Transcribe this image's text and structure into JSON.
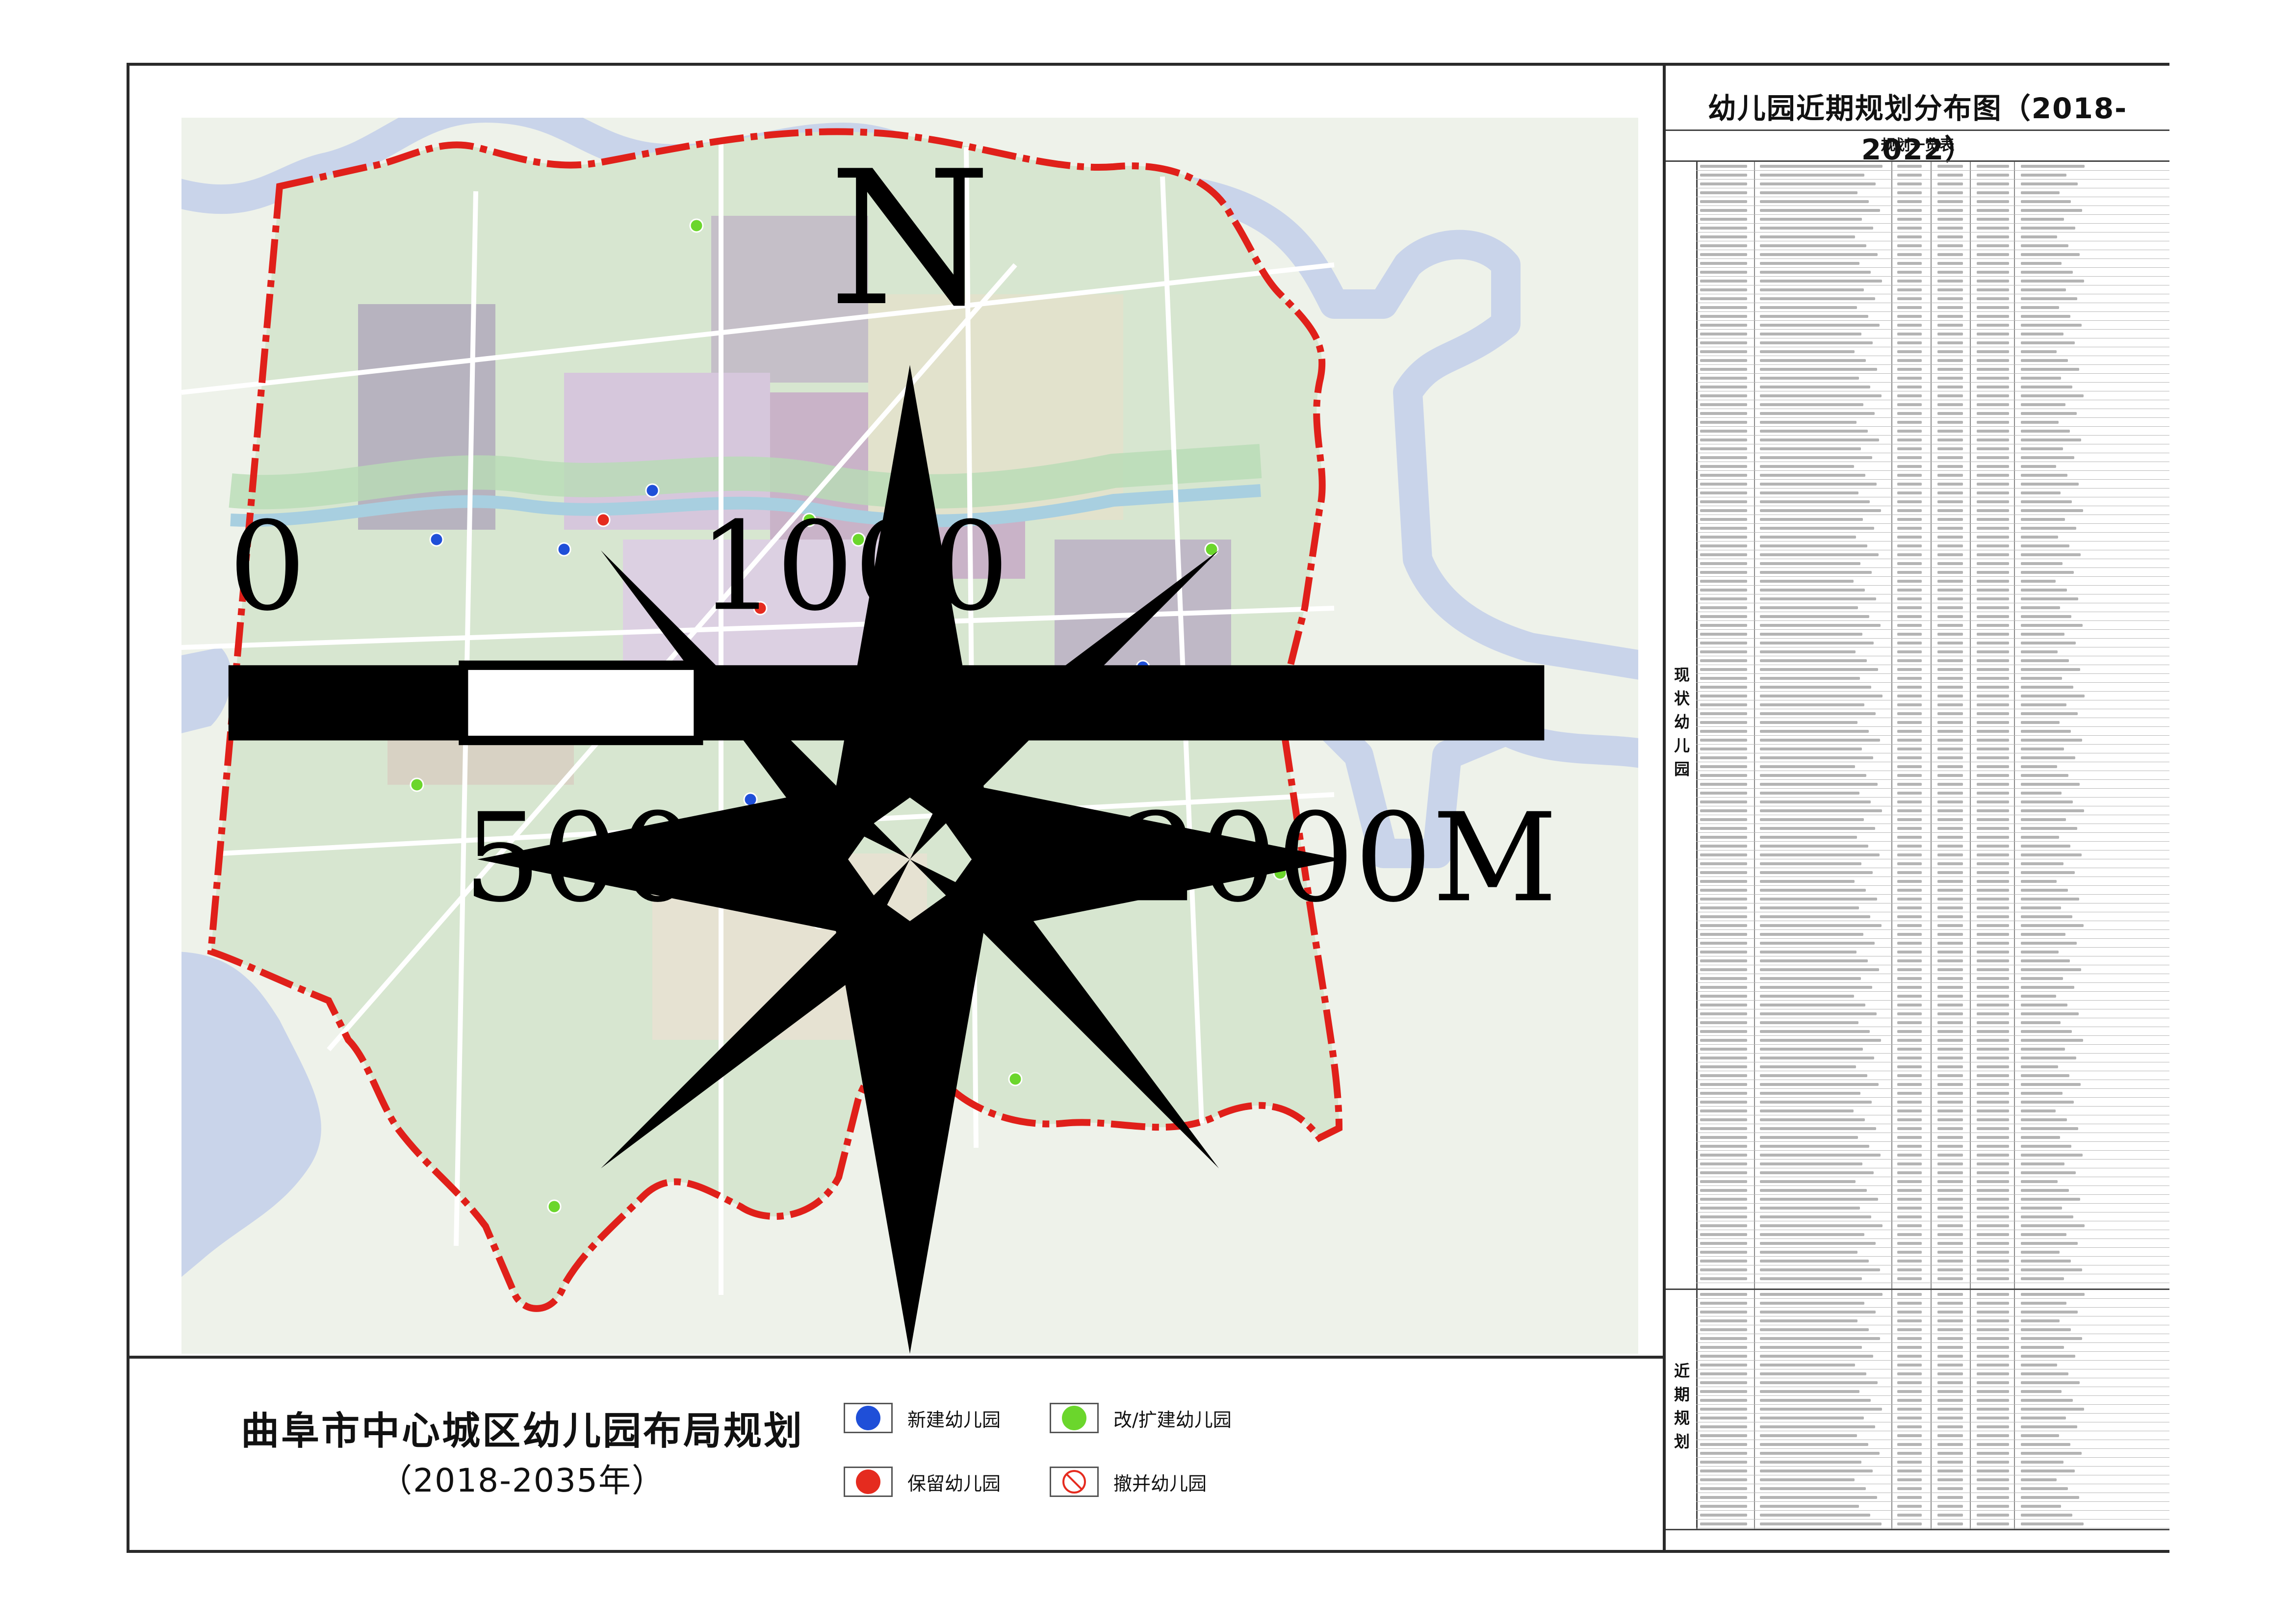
{
  "panel": {
    "title": "幼儿园近期规划分布图（2018-2022）",
    "subtitle": "规划一览表",
    "sections": [
      {
        "label": "现状幼儿园"
      },
      {
        "label": "近期规划"
      }
    ]
  },
  "title": {
    "main": "曲阜市中心城区幼儿园布局规划",
    "years": "（2018-2035年）"
  },
  "legend": [
    {
      "label": "新建幼儿园",
      "color": "#1f4fd8"
    },
    {
      "label": "改/扩建幼儿园",
      "color": "#6bd62c"
    },
    {
      "label": "保留幼儿园",
      "color": "#e52b1f"
    },
    {
      "label": "撤并幼儿园",
      "color": "#e52b1f"
    }
  ],
  "map": {
    "north_label": "N",
    "scale_labels": [
      "0",
      "1000",
      "500",
      "2000M"
    ],
    "boundary_color": "#e0201a",
    "water_color": "#c9d4ea",
    "green_color": "#b8dcb5"
  }
}
